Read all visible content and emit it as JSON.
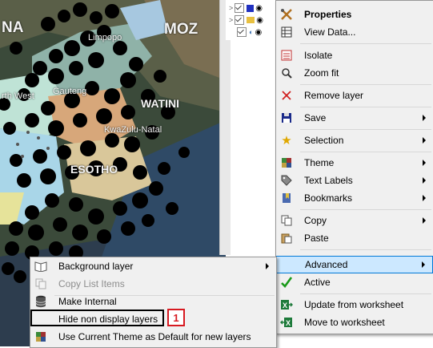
{
  "map": {
    "labels": [
      "NA",
      "MOZ",
      "Limpopo",
      "Gauteng",
      "WATINI",
      "rth West",
      "KwaZulu-Natal",
      "ESOTHO"
    ]
  },
  "context_menu": {
    "items": [
      {
        "label": "Properties",
        "icon": "tools-icon",
        "bold": true
      },
      {
        "label": "View Data...",
        "icon": "table-icon"
      },
      {
        "label": "Isolate",
        "icon": "isolate-icon"
      },
      {
        "label": "Zoom fit",
        "icon": "zoom-fit-icon"
      },
      {
        "label": "Remove layer",
        "icon": "remove-x-icon"
      },
      {
        "label": "Save",
        "icon": "floppy-disk-icon",
        "submenu": true
      },
      {
        "label": "Selection",
        "icon": "star-icon",
        "submenu": true
      },
      {
        "label": "Theme",
        "icon": "theme-icon",
        "submenu": true
      },
      {
        "label": "Text Labels",
        "icon": "tag-icon",
        "submenu": true
      },
      {
        "label": "Bookmarks",
        "icon": "bookmarks-icon",
        "submenu": true
      },
      {
        "label": "Copy",
        "icon": "copy-icon",
        "submenu": true
      },
      {
        "label": "Paste",
        "icon": "paste-icon"
      },
      {
        "label": "Advanced",
        "icon": "",
        "submenu": true,
        "highlighted": true
      },
      {
        "label": "Active",
        "icon": "checkmark-icon"
      },
      {
        "label": "Update from worksheet",
        "icon": "excel-import-icon"
      },
      {
        "label": "Move to worksheet",
        "icon": "excel-export-icon"
      }
    ]
  },
  "advanced_submenu": {
    "items": [
      {
        "label": "Background layer",
        "icon": "book-icon",
        "submenu": true
      },
      {
        "label": "Copy List Items",
        "icon": "copy-list-icon",
        "disabled": true
      },
      {
        "label": "Make Internal",
        "icon": "database-icon"
      },
      {
        "label": "Hide non display layers",
        "icon": ""
      },
      {
        "label": "Use Current Theme as Default for new layers",
        "icon": "theme-default-icon"
      }
    ]
  },
  "callout": {
    "number": "1"
  },
  "colors": {
    "highlight_bg": "#cce8ff",
    "highlight_border": "#0078d7",
    "callout_red": "#d71920"
  }
}
